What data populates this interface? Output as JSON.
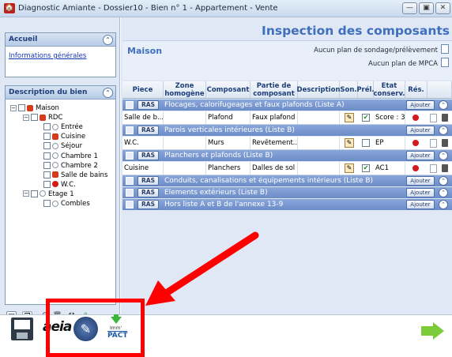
{
  "window": {
    "title": "Diagnostic Amiante - Dossier10 - Bien n° 1 - Appartement  - Vente",
    "app_icon_glyph": "🏠",
    "minimize_glyph": "—",
    "restore_glyph": "▣",
    "close_glyph": "✕"
  },
  "sidebar": {
    "accueil": {
      "title": "Accueil",
      "link": "Informations générales"
    },
    "description": {
      "title": "Description du bien",
      "tree": [
        {
          "label": "Maison",
          "level": 0,
          "icon": "red-home-icon"
        },
        {
          "label": "RDC",
          "level": 1,
          "icon": "red-home-icon"
        },
        {
          "label": "Entrée",
          "level": 2,
          "icon": "empty-circle-icon"
        },
        {
          "label": "Cuisine",
          "level": 2,
          "icon": "red-home-icon"
        },
        {
          "label": "Séjour",
          "level": 2,
          "icon": "empty-circle-icon"
        },
        {
          "label": "Chambre 1",
          "level": 2,
          "icon": "empty-circle-icon"
        },
        {
          "label": "Chambre 2",
          "level": 2,
          "icon": "empty-circle-icon"
        },
        {
          "label": "Salle de bains",
          "level": 2,
          "icon": "red-home-icon"
        },
        {
          "label": "W.C.",
          "level": 2,
          "icon": "red-dot-icon"
        },
        {
          "label": "Etage 1",
          "level": 1,
          "icon": "empty-circle-icon"
        },
        {
          "label": "Combles",
          "level": 2,
          "icon": "empty-circle-icon"
        }
      ]
    }
  },
  "main": {
    "title": "Inspection des composants",
    "section": "Maison",
    "plan_sondage": "Aucun plan de sondage/prélèvement",
    "plan_mpca": "Aucun plan de MPCA",
    "columns": [
      "Piece",
      "Zone homogène",
      "Composant",
      "Partie de composant",
      "Description",
      "Son.",
      "Prél.",
      "Etat conserv.",
      "Rés."
    ],
    "ras_label": "RAS",
    "ajouter_label": "Ajouter",
    "groups": [
      {
        "label": "Flocages, calorifugeages et faux plafonds (Liste A)",
        "rows": [
          {
            "piece": "Salle de b...",
            "zone": "",
            "composant": "Plafond",
            "partie": "Faux plafond",
            "description": "",
            "prel": true,
            "etat": "Score : 3"
          }
        ]
      },
      {
        "label": "Parois verticales intérieures (Liste B)",
        "rows": [
          {
            "piece": "W.C.",
            "zone": "",
            "composant": "Murs",
            "partie": "Revêtement...",
            "description": "",
            "prel": false,
            "etat": "EP"
          }
        ]
      },
      {
        "label": "Planchers et plafonds (Liste B)",
        "rows": [
          {
            "piece": "Cuisine",
            "zone": "",
            "composant": "Planchers",
            "partie": "Dalles de sol",
            "description": "",
            "prel": true,
            "etat": "AC1"
          }
        ]
      },
      {
        "label": "Conduits, canalisations et équipements intérieurs (Liste B)",
        "rows": []
      },
      {
        "label": "Elements extérieurs (Liste B)",
        "rows": []
      },
      {
        "label": "Hors liste A et B de l'annexe 13-9",
        "rows": []
      }
    ]
  },
  "bottom": {
    "logo": "aeia",
    "imm_label": "Imm'",
    "pact_label": "PACT"
  },
  "colors": {
    "title_blue": "#3f6fbd",
    "group_bar": "#7897cf",
    "highlight_red": "#ff0000",
    "next_arrow": "#7ccc3a"
  }
}
